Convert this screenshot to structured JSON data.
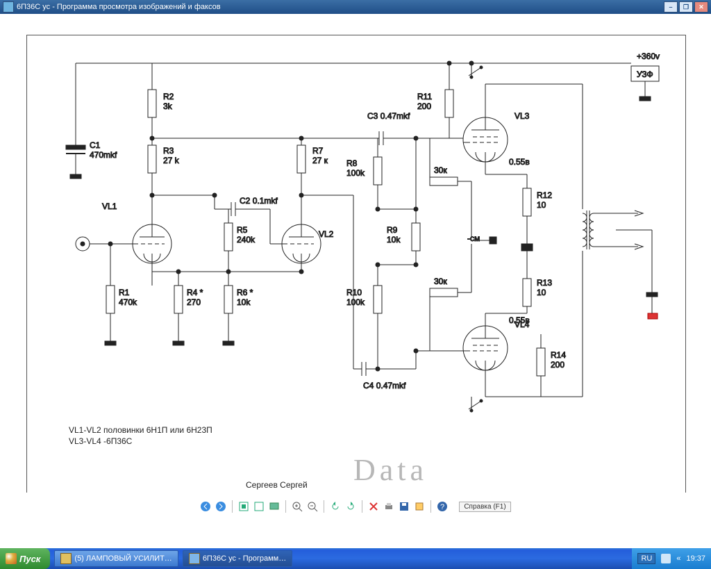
{
  "window": {
    "title": "6П36С ус - Программа просмотра изображений и факсов",
    "min_icon": "–",
    "max_icon": "❐",
    "close_icon": "✕"
  },
  "schematic": {
    "supply": "+360v",
    "uzf": "УЗФ",
    "components": {
      "C1": {
        "name": "C1",
        "value": "470mkf"
      },
      "C2": {
        "name": "C2",
        "value": "0.1mkf"
      },
      "C3": {
        "name": "C3",
        "value": "0.47mkf"
      },
      "C4": {
        "name": "C4",
        "value": "0.47mkf"
      },
      "R1": {
        "name": "R1",
        "value": "470k"
      },
      "R2": {
        "name": "R2",
        "value": "3k"
      },
      "R3": {
        "name": "R3",
        "value": "27 k"
      },
      "R4": {
        "name": "R4 *",
        "value": "270"
      },
      "R5": {
        "name": "R5",
        "value": "240k"
      },
      "R6": {
        "name": "R6 *",
        "value": "10k"
      },
      "R7": {
        "name": "R7",
        "value": "27 к"
      },
      "R8": {
        "name": "R8",
        "value": "100k"
      },
      "R9": {
        "name": "R9",
        "value": "10k"
      },
      "R10": {
        "name": "R10",
        "value": "100k"
      },
      "R11": {
        "name": "R11",
        "value": "200"
      },
      "R12": {
        "name": "R12",
        "value": "10"
      },
      "R13": {
        "name": "R13",
        "value": "10"
      },
      "R14": {
        "name": "R14",
        "value": "200"
      }
    },
    "tubes": {
      "VL1": "VL1",
      "VL2": "VL2",
      "VL3": "VL3",
      "VL4": "VL4"
    },
    "grid_res": "30к",
    "bias": "-см",
    "cathode_voltage_top": "0.55в",
    "cathode_voltage_bot": "0.55в",
    "notes_line1": "VL1-VL2 половинки 6Н1П или 6Н23П",
    "notes_line2": "VL3-VL4 -6П36С",
    "author": "Сергеев Сергей",
    "watermark": "Data"
  },
  "toolbar": {
    "help": "Справка (F1)"
  },
  "taskbar": {
    "start": "Пуск",
    "task1": "(5) ЛАМПОВЫЙ УСИЛИТ…",
    "task2": "6П36С ус - Программ…",
    "lang": "RU",
    "clock": "19:37",
    "chevrons": "«"
  }
}
